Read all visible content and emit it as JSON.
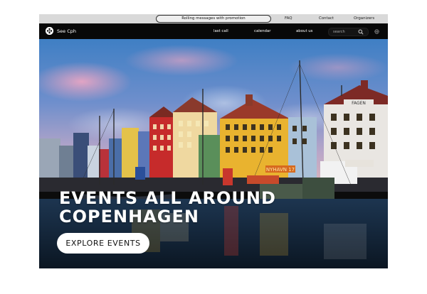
{
  "topbar": {
    "rolling_message": "Rolling messages with promotion",
    "links": [
      "FAQ",
      "Contact",
      "Organizers"
    ]
  },
  "nav": {
    "logo_text": "See Cph",
    "links": [
      "last call",
      "calendar",
      "about us"
    ],
    "search_placeholder": "search"
  },
  "hero": {
    "title_line1": "EVENTS ALL AROUND",
    "title_line2": "COPENHAGEN",
    "cta_label": "EXPLORE EVENTS",
    "storefront_sign": "NYHAVN 17",
    "building_sign": "FAGEN"
  },
  "colors": {
    "topbar_bg": "#d9d9d9",
    "nav_bg": "#080808",
    "cta_bg": "#ffffff",
    "hero_text": "#ffffff"
  }
}
